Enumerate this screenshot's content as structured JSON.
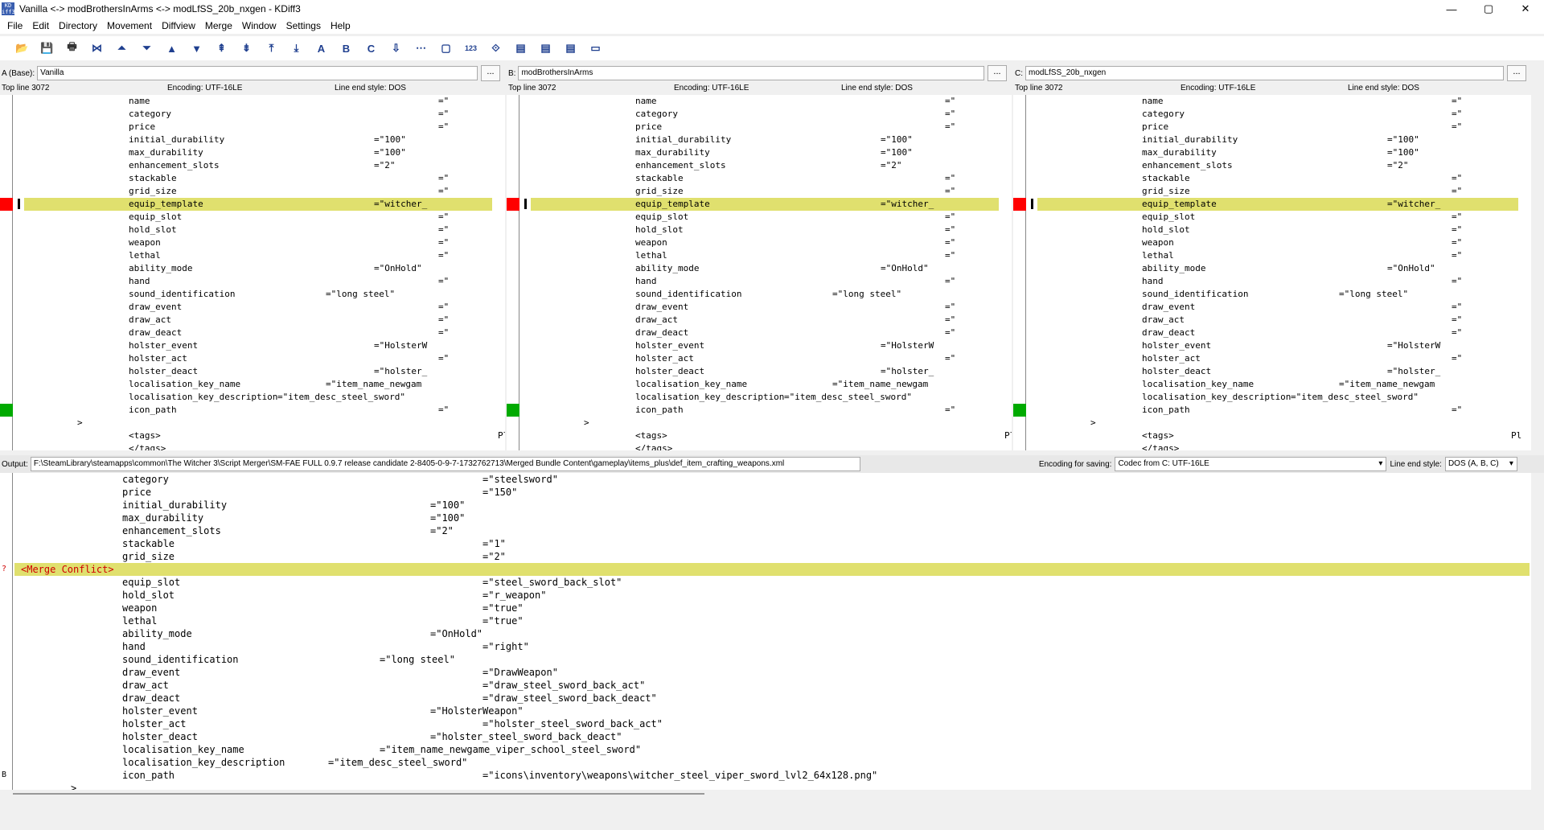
{
  "window": {
    "title": "Vanilla <-> modBrothersInArms <-> modLfSS_20b_nxgen - KDiff3",
    "app_icon": "kdiff3-icon",
    "controls": [
      "—",
      "▢",
      "✕"
    ]
  },
  "menu": [
    "File",
    "Edit",
    "Directory",
    "Movement",
    "Diffview",
    "Merge",
    "Window",
    "Settings",
    "Help"
  ],
  "toolbar": [
    {
      "name": "open-icon",
      "glyph": "📂"
    },
    {
      "name": "save-icon",
      "glyph": "💾"
    },
    {
      "name": "print-icon",
      "glyph": "🖶"
    },
    {
      "name": "goto-top-icon",
      "glyph": "⋈"
    },
    {
      "name": "prev-delta-icon",
      "glyph": "⏶"
    },
    {
      "name": "next-delta-icon",
      "glyph": "⏷"
    },
    {
      "name": "prev-conflict-icon",
      "glyph": "▲"
    },
    {
      "name": "next-conflict-icon",
      "glyph": "▼"
    },
    {
      "name": "prev-unsolved-icon",
      "glyph": "⇞"
    },
    {
      "name": "next-unsolved-icon",
      "glyph": "⇟"
    },
    {
      "name": "first-delta-icon",
      "glyph": "⤒"
    },
    {
      "name": "last-delta-icon",
      "glyph": "⤓"
    },
    {
      "name": "choose-a-icon",
      "glyph": "A"
    },
    {
      "name": "choose-b-icon",
      "glyph": "B"
    },
    {
      "name": "choose-c-icon",
      "glyph": "C"
    },
    {
      "name": "auto-advance-icon",
      "glyph": "⇩"
    },
    {
      "name": "show-whitespace-icon",
      "glyph": "⋯"
    },
    {
      "name": "show-whitespace-chars-icon",
      "glyph": "▢"
    },
    {
      "name": "line-numbers-icon",
      "glyph": "123"
    },
    {
      "name": "word-wrap-icon",
      "glyph": "⟐"
    },
    {
      "name": "show-window-a-icon",
      "glyph": "▤"
    },
    {
      "name": "show-window-b-icon",
      "glyph": "▤"
    },
    {
      "name": "show-window-c-icon",
      "glyph": "▤"
    },
    {
      "name": "overview-icon",
      "glyph": "▭"
    }
  ],
  "panes": [
    {
      "label": "A (Base):",
      "path": "Vanilla",
      "dots": "...",
      "top_line": "Top line 3072",
      "encoding": "Encoding: UTF-16LE",
      "line_end": "Line end style: DOS"
    },
    {
      "label": "B:",
      "path": "modBrothersInArms",
      "dots": "...",
      "top_line": "Top line 3072",
      "encoding": "Encoding: UTF-16LE",
      "line_end": "Line end style: DOS"
    },
    {
      "label": "C:",
      "path": "modLfSS_20b_nxgen",
      "dots": "...",
      "top_line": "Top line 3072",
      "encoding": "Encoding: UTF-16LE",
      "line_end": "Line end style: DOS"
    }
  ],
  "diff_lines": [
    {
      "name": "name",
      "value": "=\""
    },
    {
      "name": "category",
      "value": "=\""
    },
    {
      "name": "price",
      "value": "=\""
    },
    {
      "name": "initial_durability",
      "value": "=\"100\""
    },
    {
      "name": "max_durability",
      "value": "=\"100\""
    },
    {
      "name": "enhancement_slots",
      "value": "=\"2\""
    },
    {
      "name": "stackable",
      "value": "=\""
    },
    {
      "name": "grid_size",
      "value": "=\""
    },
    {
      "name": "equip_template",
      "value": "=\"witcher_"
    },
    {
      "name": "equip_slot",
      "value": "=\""
    },
    {
      "name": "hold_slot",
      "value": "=\""
    },
    {
      "name": "weapon",
      "value": "=\""
    },
    {
      "name": "lethal",
      "value": "=\""
    },
    {
      "name": "ability_mode",
      "value": "=\"OnHold\""
    },
    {
      "name": "hand",
      "value": "=\""
    },
    {
      "name": "sound_identification",
      "value": "=\"long steel\""
    },
    {
      "name": "draw_event",
      "value": "=\""
    },
    {
      "name": "draw_act",
      "value": "=\""
    },
    {
      "name": "draw_deact",
      "value": "=\""
    },
    {
      "name": "holster_event",
      "value": "=\"HolsterW"
    },
    {
      "name": "holster_act",
      "value": "=\""
    },
    {
      "name": "holster_deact",
      "value": "=\"holster_"
    },
    {
      "name": "localisation_key_name",
      "value": "=\"item_name_newgam"
    },
    {
      "name": "localisation_key_description",
      "value": "=\"item_desc_steel_sword\""
    },
    {
      "name": "icon_path",
      "value": "=\""
    },
    {
      "name": ">",
      "value": ""
    },
    {
      "name": "<tags>",
      "value": "Pl"
    },
    {
      "name": "</tags>",
      "value": ""
    }
  ],
  "output_bar": {
    "label": "Output:",
    "path": "F:\\SteamLibrary\\steamapps\\common\\The Witcher 3\\Script Merger\\SM-FAE FULL 0.9.7 release candidate 2-8405-0-9-7-1732762713\\Merged Bundle Content\\gameplay\\items_plus\\def_item_crafting_weapons.xml",
    "encoding_label": "Encoding for saving:",
    "encoding_value": "Codec from C: UTF-16LE",
    "line_end_label": "Line end style:",
    "line_end_value": "DOS (A, B, C)"
  },
  "output_lines": [
    {
      "name": "category",
      "value": "=\"steelsword\""
    },
    {
      "name": "price",
      "value": "=\"150\""
    },
    {
      "name": "initial_durability",
      "value": "=\"100\""
    },
    {
      "name": "max_durability",
      "value": "=\"100\""
    },
    {
      "name": "enhancement_slots",
      "value": "=\"2\""
    },
    {
      "name": "stackable",
      "value": "=\"1\""
    },
    {
      "name": "grid_size",
      "value": "=\"2\""
    },
    {
      "name": "<Merge Conflict>",
      "value": "",
      "conflict": true,
      "gutter": "?"
    },
    {
      "name": "equip_slot",
      "value": "=\"steel_sword_back_slot\""
    },
    {
      "name": "hold_slot",
      "value": "=\"r_weapon\""
    },
    {
      "name": "weapon",
      "value": "=\"true\""
    },
    {
      "name": "lethal",
      "value": "=\"true\""
    },
    {
      "name": "ability_mode",
      "value": "=\"OnHold\""
    },
    {
      "name": "hand",
      "value": "=\"right\""
    },
    {
      "name": "sound_identification",
      "value": "=\"long steel\""
    },
    {
      "name": "draw_event",
      "value": "=\"DrawWeapon\""
    },
    {
      "name": "draw_act",
      "value": "=\"draw_steel_sword_back_act\""
    },
    {
      "name": "draw_deact",
      "value": "=\"draw_steel_sword_back_deact\""
    },
    {
      "name": "holster_event",
      "value": "=\"HolsterWeapon\""
    },
    {
      "name": "holster_act",
      "value": "=\"holster_steel_sword_back_act\""
    },
    {
      "name": "holster_deact",
      "value": "=\"holster_steel_sword_back_deact\""
    },
    {
      "name": "localisation_key_name",
      "value": "=\"item_name_newgame_viper_school_steel_sword\""
    },
    {
      "name": "localisation_key_description",
      "value": "=\"item_desc_steel_sword\""
    },
    {
      "name": "icon_path",
      "value": "=\"icons\\inventory\\weapons\\witcher_steel_viper_sword_lvl2_64x128.png\"",
      "gutter": "B"
    },
    {
      "name": ">",
      "value": ""
    }
  ],
  "colors": {
    "highlight": "#e0e06e",
    "conflict_text": "#d00000",
    "mark_red": "#ff0000",
    "mark_green": "#00aa00"
  }
}
